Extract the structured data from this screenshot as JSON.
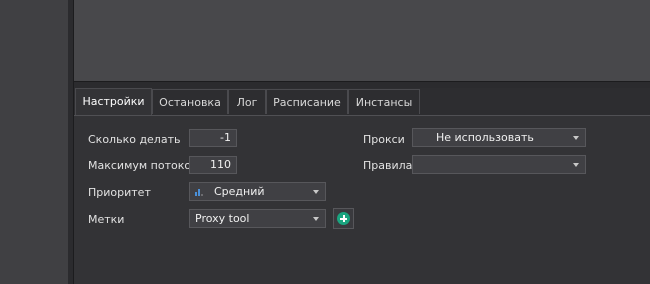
{
  "tabs": [
    {
      "label": "Настройки",
      "active": true
    },
    {
      "label": "Остановка",
      "active": false
    },
    {
      "label": "Лог",
      "active": false
    },
    {
      "label": "Расписание",
      "active": false
    },
    {
      "label": "Инстансы",
      "active": false
    }
  ],
  "settings": {
    "count_label": "Сколько делать",
    "count_value": "-1",
    "threads_label": "Максимум потоков",
    "threads_value": "110",
    "priority_label": "Приоритет",
    "priority_value": "Средний",
    "tags_label": "Метки",
    "tags_value": "Proxy tool",
    "proxy_label": "Прокси",
    "proxy_value": "Не использовать",
    "rules_label": "Правила",
    "rules_value": ""
  },
  "colors": {
    "accent_add": "#1aa47f",
    "priority_icon": "#4a90d9"
  },
  "icons": {
    "add": "plus-circle-icon",
    "priority": "priority-bars-icon",
    "dropdown": "chevron-down-icon"
  }
}
